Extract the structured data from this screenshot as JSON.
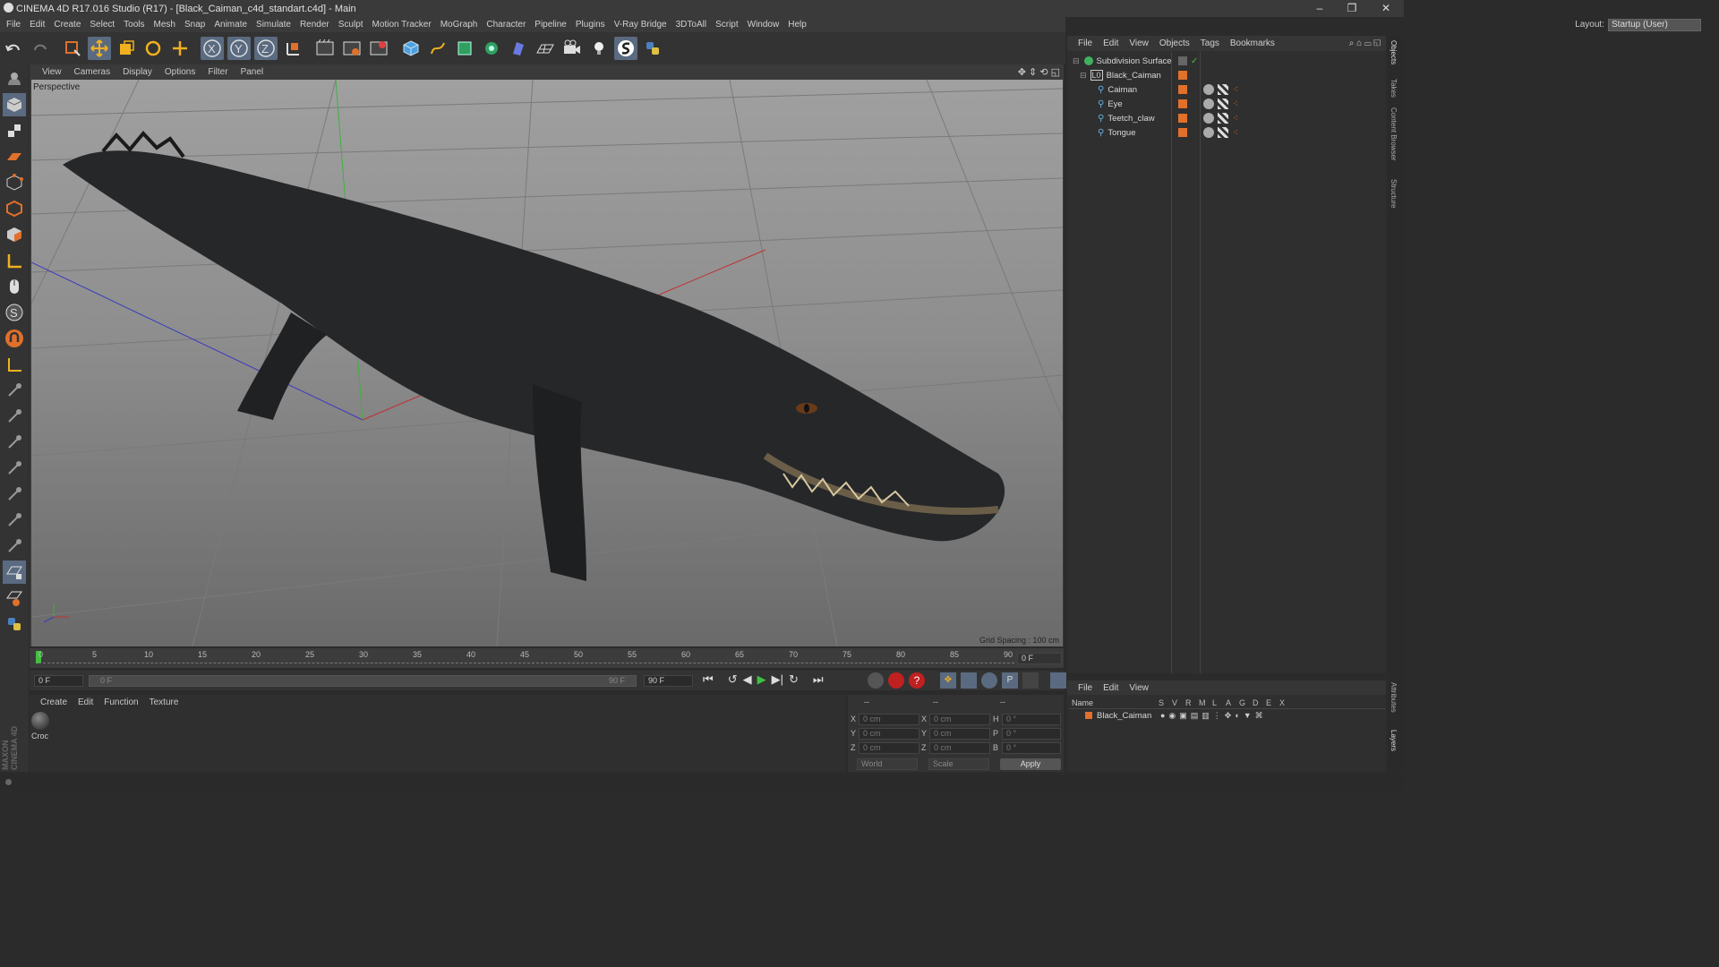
{
  "app": {
    "title": "CINEMA 4D R17.016 Studio (R17) - [Black_Caiman_c4d_standart.c4d] - Main"
  },
  "menu": [
    "File",
    "Edit",
    "Create",
    "Select",
    "Tools",
    "Mesh",
    "Snap",
    "Animate",
    "Simulate",
    "Render",
    "Sculpt",
    "Motion Tracker",
    "MoGraph",
    "Character",
    "Pipeline",
    "Plugins",
    "V-Ray Bridge",
    "3DToAll",
    "Script",
    "Window",
    "Help"
  ],
  "layout": {
    "label": "Layout:",
    "value": "Startup (User)"
  },
  "viewport": {
    "menu": [
      "View",
      "Cameras",
      "Display",
      "Options",
      "Filter",
      "Panel"
    ],
    "camera_label": "Perspective",
    "grid_spacing": "Grid Spacing : 100 cm"
  },
  "timeline": {
    "ticks": [
      "0",
      "5",
      "10",
      "15",
      "20",
      "25",
      "30",
      "35",
      "40",
      "45",
      "50",
      "55",
      "60",
      "65",
      "70",
      "75",
      "80",
      "85",
      "90"
    ],
    "current_frame": "0 F",
    "start_field": "0 F",
    "range_start": "0 F",
    "range_end": "90 F",
    "end_field": "90 F"
  },
  "material_manager": {
    "menu": [
      "Create",
      "Edit",
      "Function",
      "Texture"
    ],
    "materials": [
      {
        "name": "Croc"
      }
    ]
  },
  "coordinates": {
    "headers": [
      "--",
      "--",
      "--"
    ],
    "rows": [
      {
        "axis": "X",
        "pos": "0 cm",
        "size_axis": "X",
        "size": "0 cm",
        "rot_axis": "H",
        "rot": "0 °"
      },
      {
        "axis": "Y",
        "pos": "0 cm",
        "size_axis": "Y",
        "size": "0 cm",
        "rot_axis": "P",
        "rot": "0 °"
      },
      {
        "axis": "Z",
        "pos": "0 cm",
        "size_axis": "Z",
        "size": "0 cm",
        "rot_axis": "B",
        "rot": "0 °"
      }
    ],
    "mode_select": "World",
    "scale_select": "Scale",
    "apply_label": "Apply"
  },
  "object_manager": {
    "menu": [
      "File",
      "Edit",
      "View",
      "Objects",
      "Tags",
      "Bookmarks"
    ],
    "objects": [
      {
        "name": "Subdivision Surface",
        "indent": 0
      },
      {
        "name": "Black_Caiman",
        "indent": 1
      },
      {
        "name": "Caiman",
        "indent": 2
      },
      {
        "name": "Eye",
        "indent": 2
      },
      {
        "name": "Teetch_claw",
        "indent": 2
      },
      {
        "name": "Tongue",
        "indent": 2
      }
    ]
  },
  "layer_manager": {
    "menu": [
      "File",
      "Edit",
      "View"
    ],
    "columns": [
      "Name",
      "S",
      "V",
      "R",
      "M",
      "L",
      "A",
      "G",
      "D",
      "E",
      "X"
    ],
    "layers": [
      {
        "name": "Black_Caiman"
      }
    ]
  },
  "side_tabs": [
    "Objects",
    "Takes",
    "Content Browser",
    "Structure",
    "Attributes",
    "Layers"
  ],
  "brand": "MAXON CINEMA 4D",
  "colors": {
    "accent_orange": "#e0702a",
    "panel": "#2f2f2f",
    "viewport_top": "#a0a0a0"
  }
}
